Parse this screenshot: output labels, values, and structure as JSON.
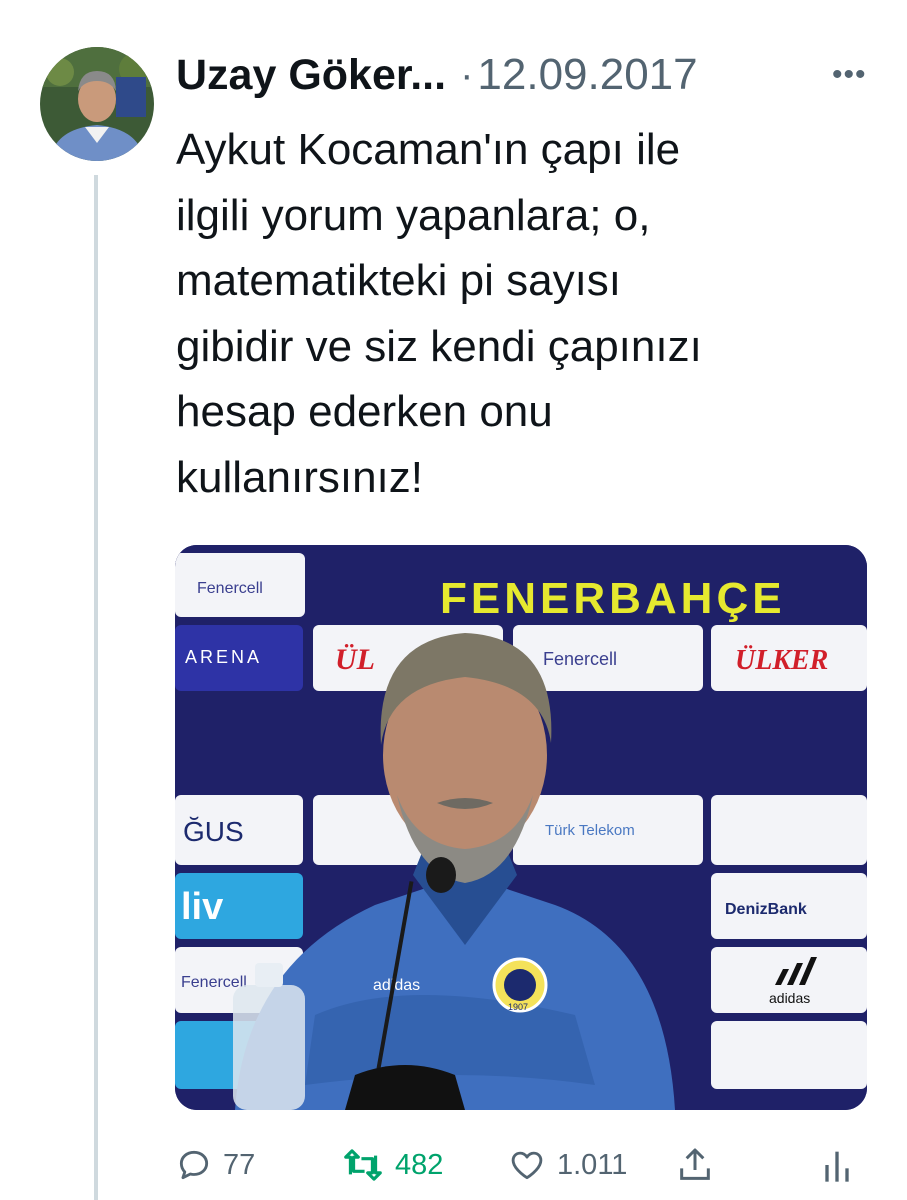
{
  "tweet": {
    "author_name": "Uzay Göker...",
    "separator": "·",
    "date": "12.09.2017",
    "more_icon": "more-dots-icon",
    "text": "Aykut Kocaman'ın çapı ile\nilgili yorum yapanlara; o,\nmatematikteki pi sayısı\ngibidir ve siz kendi çapınızı\nhesap ederken onu\nkullanırsınız!"
  },
  "media": {
    "banner_title": "FENERBAHÇE",
    "sponsors": {
      "ulker_top_left": "ÜL",
      "ulker_top_right": "ÜLKER",
      "fenercell_center": "Fenercell",
      "fenercell_left": "Fenercell",
      "left_row2": "ARENA",
      "dogus": "ĞUS",
      "liv": "liv",
      "denizbank": "DenizBank",
      "adidas": "adidas",
      "turk_telekom": "Türk Telekom",
      "left_row5": "Fenercell"
    },
    "jacket_brand": "adidas",
    "crest_year": "1907"
  },
  "actions": {
    "reply_icon": "reply-bubble-icon",
    "reply_count": "77",
    "retweet_icon": "retweet-icon",
    "retweet_count": "482",
    "like_icon": "heart-icon",
    "like_count": "1.011",
    "share_icon": "share-icon",
    "analytics_icon": "analytics-icon"
  },
  "colors": {
    "retweet_active": "#00a36c",
    "secondary_text": "#536471",
    "banner_yellow": "#e6e92f",
    "board_navy": "#1b1d63"
  }
}
